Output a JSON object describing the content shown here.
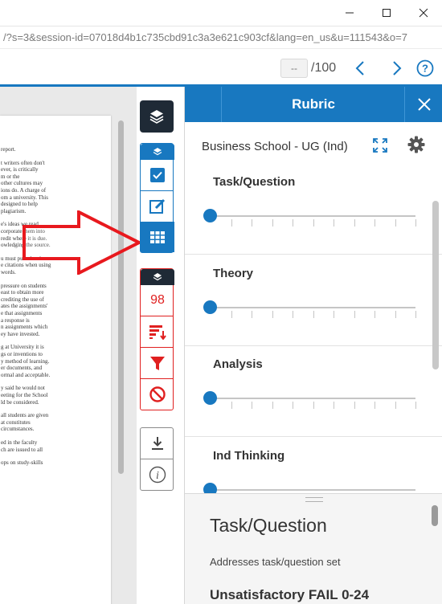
{
  "browser": {
    "url": "/?s=3&session-id=07018d4b1c735cbd91c3a3e621c903cf&lang=en_us&u=111543&o=7"
  },
  "toolbar": {
    "page_input_placeholder": "--",
    "page_total": "/100"
  },
  "document_text": [
    "report.",
    "t writers often don't",
    "ever, is critically",
    "m or the",
    "other cultures may",
    "ions do. A charge of",
    "om a university. This",
    "designed to help",
    "plagiarism.",
    "e's ideas we read",
    "corporate them into",
    "redit where it is due.",
    "owledging the source.",
    "u must put others'",
    "e citations when using",
    "words.",
    "pressure on students",
    "east to obtain more",
    "crediting the use of",
    "ates the assignments'",
    "e that assignments",
    "a response is",
    "n assignments which",
    "ey have invested.",
    "g at University it is",
    "gs or inventions to",
    "y method of learning.",
    "er documents, and",
    "ormal and acceptable.",
    "y said he would not",
    "eeting for the School",
    "ld be considered.",
    "all students are given",
    "at constitutes",
    "circumstances.",
    "ed in the faculty",
    "ch are issued to all",
    "ops on study-skills"
  ],
  "tools": {
    "score_value": "98"
  },
  "rubric": {
    "title": "Rubric",
    "name": "Business School - UG (Ind)",
    "criteria": [
      {
        "title": "Task/Question",
        "value": 0
      },
      {
        "title": "Theory",
        "value": 0
      },
      {
        "title": "Analysis",
        "value": 0
      },
      {
        "title": "Ind Thinking",
        "value": 0
      }
    ],
    "detail": {
      "title": "Task/Question",
      "description": "Addresses task/question set",
      "level": "Unsatisfactory FAIL 0-24"
    }
  },
  "colors": {
    "accent": "#1878c0",
    "dark": "#1f2a36",
    "red": "#e02020",
    "arrow_red": "#e8191e"
  },
  "icons": [
    "minimize-icon",
    "maximize-icon",
    "close-icon",
    "chevron-left-icon",
    "chevron-right-icon",
    "help-icon",
    "layers-icon",
    "checkbox-icon",
    "edit-icon",
    "grid-icon",
    "sort-icon",
    "filter-icon",
    "block-icon",
    "download-icon",
    "info-icon",
    "expand-icon",
    "gear-icon"
  ]
}
